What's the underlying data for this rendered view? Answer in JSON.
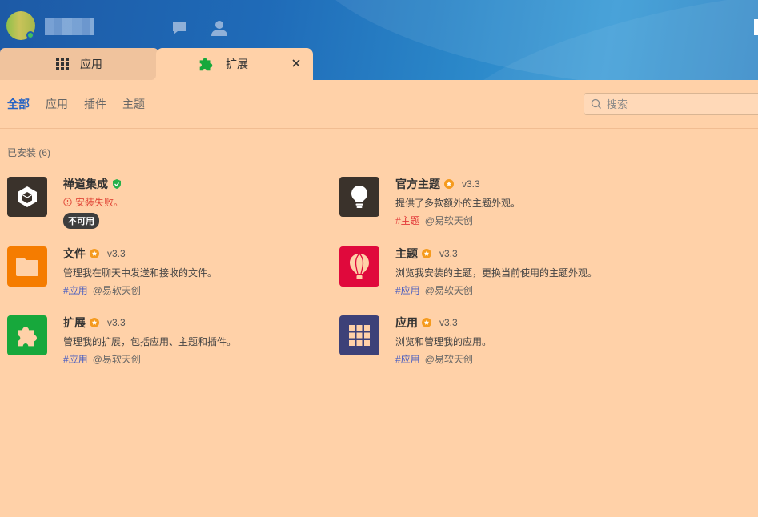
{
  "tabs": [
    {
      "label": "应用"
    },
    {
      "label": "扩展"
    }
  ],
  "filters": [
    "全部",
    "应用",
    "插件",
    "主题"
  ],
  "search": {
    "placeholder": "搜索"
  },
  "section": {
    "title": "已安装 (6)"
  },
  "extensions": [
    {
      "name": "禅道集成",
      "error": "安装失败。",
      "status": "不可用",
      "logo_color": "#3a322b"
    },
    {
      "name": "官方主题",
      "version": "v3.3",
      "desc": "提供了多款额外的主题外观。",
      "tag": "#主题",
      "author": "@易软天创",
      "logo_color": "#3a322b"
    },
    {
      "name": "文件",
      "version": "v3.3",
      "desc": "管理我在聊天中发送和接收的文件。",
      "tag": "#应用",
      "author": "@易软天创",
      "logo_color": "#f57c00"
    },
    {
      "name": "主题",
      "version": "v3.3",
      "desc": "浏览我安装的主题，更换当前使用的主题外观。",
      "tag": "#应用",
      "author": "@易软天创",
      "logo_color": "#e0093c"
    },
    {
      "name": "扩展",
      "version": "v3.3",
      "desc": "管理我的扩展，包括应用、主题和插件。",
      "tag": "#应用",
      "author": "@易软天创",
      "logo_color": "#17a83c"
    },
    {
      "name": "应用",
      "version": "v3.3",
      "desc": "浏览和管理我的应用。",
      "tag": "#应用",
      "author": "@易软天创",
      "logo_color": "#3d4178"
    }
  ],
  "colors": {
    "accent": "#2563c4",
    "background": "#ffd1a8",
    "header": "#1f6bb8"
  }
}
